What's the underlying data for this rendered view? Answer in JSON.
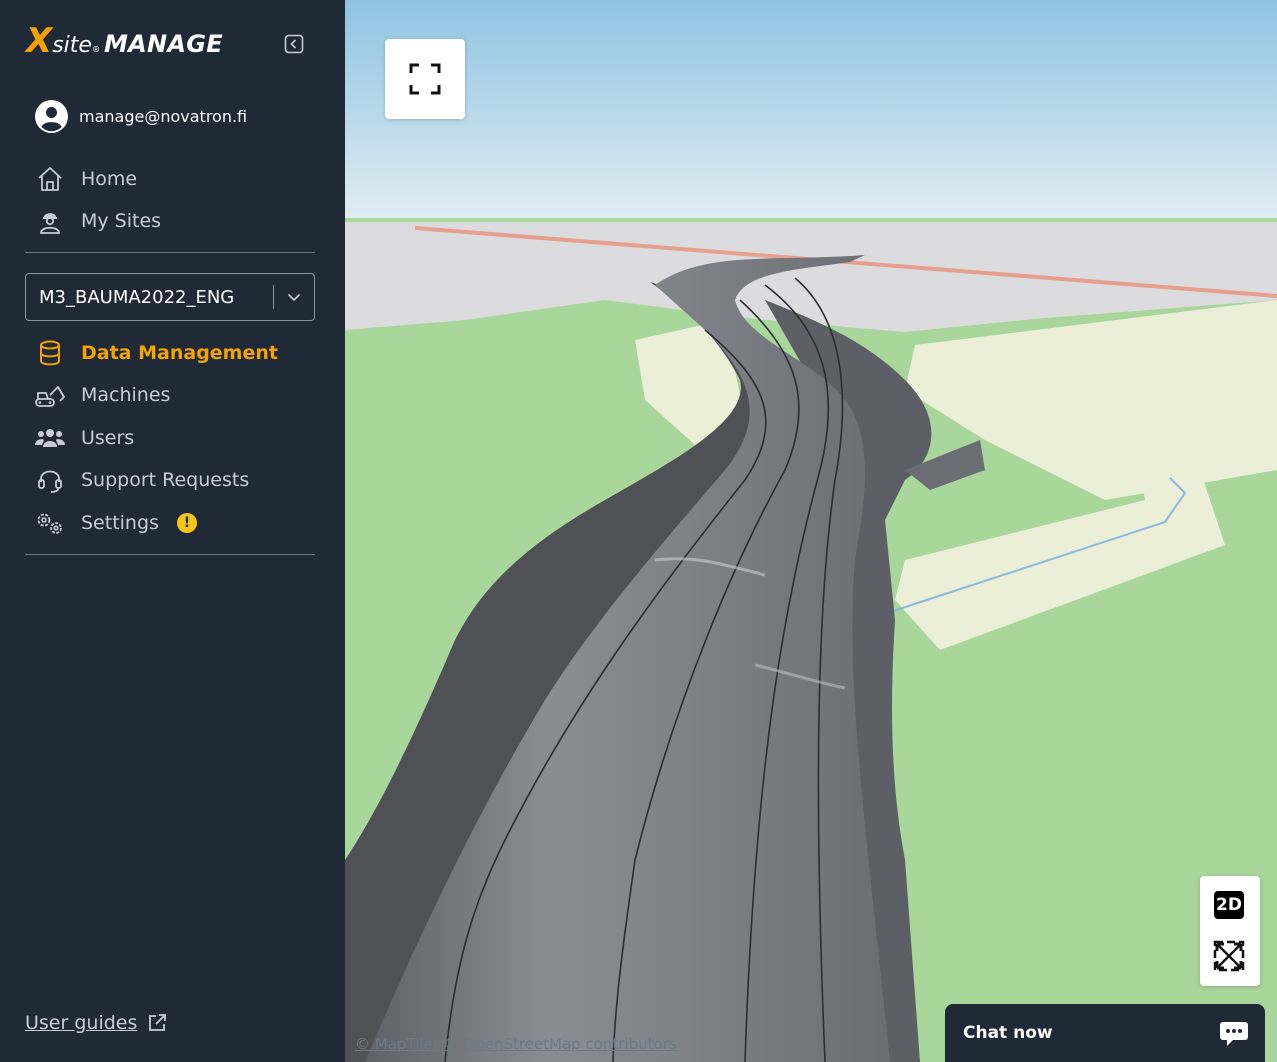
{
  "brand": {
    "x": "X",
    "site": "site",
    "reg": "®",
    "manage": "MANAGE"
  },
  "user": {
    "email": "manage@novatron.fi"
  },
  "nav_top": [
    {
      "label": "Home",
      "icon": "home-icon"
    },
    {
      "label": "My Sites",
      "icon": "worker-icon"
    }
  ],
  "site_selector": {
    "value": "M3_BAUMA2022_ENG"
  },
  "nav_site": [
    {
      "label": "Data Management",
      "icon": "database-icon",
      "active": true
    },
    {
      "label": "Machines",
      "icon": "excavator-icon"
    },
    {
      "label": "Users",
      "icon": "users-icon"
    },
    {
      "label": "Support Requests",
      "icon": "headset-icon"
    },
    {
      "label": "Settings",
      "icon": "gears-icon",
      "badge": "!"
    }
  ],
  "footer": {
    "user_guides": "User guides"
  },
  "map": {
    "view_toggle": "2D",
    "attribution_maptiler": "© MapTiler",
    "attribution_osm": "© OpenStreetMap contributors"
  },
  "chat": {
    "label": "Chat now"
  },
  "colors": {
    "accent": "#f4a300",
    "sidebar_bg": "#1f2a36",
    "badge": "#f5c518"
  }
}
